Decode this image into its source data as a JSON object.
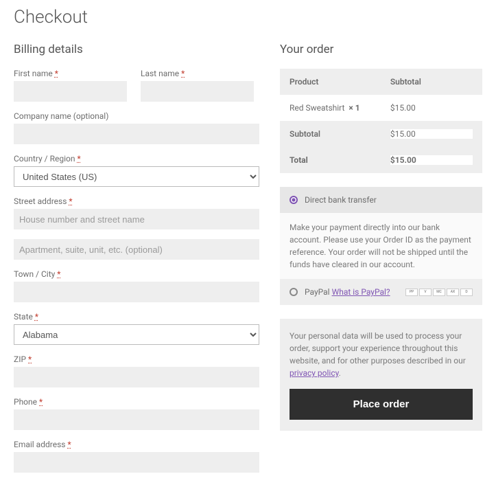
{
  "page_title": "Checkout",
  "billing": {
    "heading": "Billing details",
    "first_name_label": "First name",
    "last_name_label": "Last name",
    "company_label": "Company name (optional)",
    "country_label": "Country / Region",
    "country_value": "United States (US)",
    "street_label": "Street address",
    "street1_placeholder": "House number and street name",
    "street2_placeholder": "Apartment, suite, unit, etc. (optional)",
    "town_label": "Town / City",
    "state_label": "State",
    "state_value": "Alabama",
    "zip_label": "ZIP",
    "phone_label": "Phone",
    "email_label": "Email address"
  },
  "order": {
    "heading": "Your order",
    "col_product": "Product",
    "col_subtotal": "Subtotal",
    "items": [
      {
        "name": "Red Sweatshirt",
        "qty": "× 1",
        "price": "$15.00"
      }
    ],
    "subtotal_label": "Subtotal",
    "subtotal_value": "$15.00",
    "total_label": "Total",
    "total_value": "$15.00"
  },
  "payment": {
    "bank_label": "Direct bank transfer",
    "bank_desc": "Make your payment directly into our bank account. Please use your Order ID as the payment reference. Your order will not be shipped until the funds have cleared in our account.",
    "paypal_label": "PayPal",
    "paypal_link": "What is PayPal?"
  },
  "privacy": {
    "text_prefix": "Your personal data will be used to process your order, support your experience throughout this website, and for other purposes described in our ",
    "link": "privacy policy",
    "text_suffix": "."
  },
  "place_order_label": "Place order"
}
